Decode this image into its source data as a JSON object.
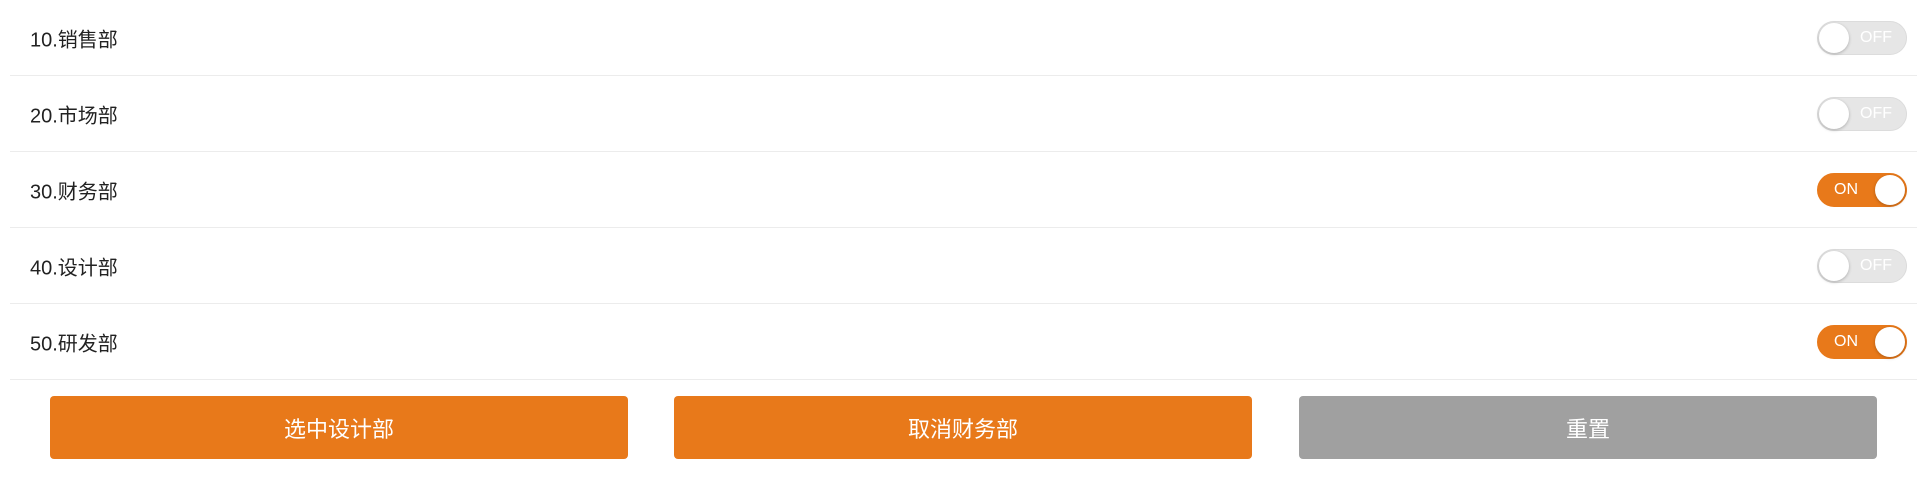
{
  "departments": [
    {
      "label": "10.销售部",
      "state": "off",
      "state_text": "OFF"
    },
    {
      "label": "20.市场部",
      "state": "off",
      "state_text": "OFF"
    },
    {
      "label": "30.财务部",
      "state": "on",
      "state_text": "ON"
    },
    {
      "label": "40.设计部",
      "state": "off",
      "state_text": "OFF"
    },
    {
      "label": "50.研发部",
      "state": "on",
      "state_text": "ON"
    }
  ],
  "actions": {
    "select_design": "选中设计部",
    "cancel_finance": "取消财务部",
    "reset": "重置"
  },
  "colors": {
    "accent": "#e8791a",
    "toggle_off": "#e6e6e6",
    "reset_button": "#a0a0a0"
  }
}
